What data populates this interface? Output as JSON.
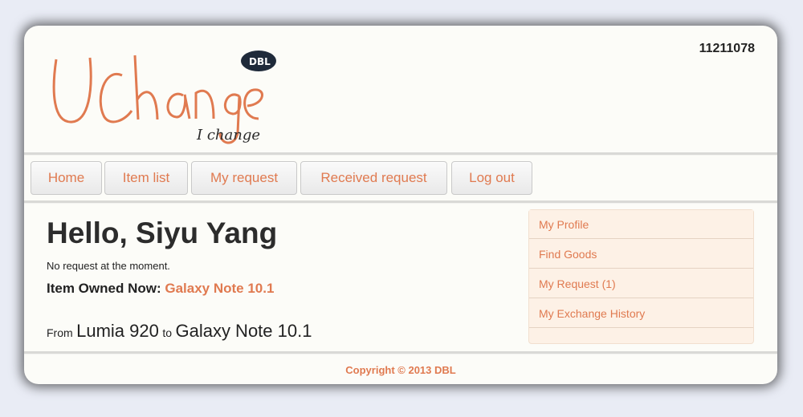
{
  "header": {
    "user_id": "11211078",
    "logo": {
      "brand": "UChange",
      "badge": "DBL",
      "tagline": "I change"
    }
  },
  "nav": {
    "items": [
      {
        "label": "Home"
      },
      {
        "label": "Item list"
      },
      {
        "label": "My request"
      },
      {
        "label": "Received request"
      },
      {
        "label": "Log out"
      }
    ]
  },
  "main": {
    "greeting": "Hello, Siyu Yang",
    "request_note": "No request at the moment.",
    "owned_label": "Item Owned Now:",
    "owned_item": "Galaxy Note 10.1",
    "history": {
      "from_word": "From",
      "from_item": "Lumia 920",
      "to_word": "to",
      "to_item": "Galaxy Note 10.1"
    }
  },
  "sidebar": {
    "items": [
      {
        "label": "My Profile"
      },
      {
        "label": "Find Goods"
      },
      {
        "label": "My Request (1)"
      },
      {
        "label": "My Exchange History"
      }
    ]
  },
  "footer": {
    "copyright": "Copyright © 2013 DBL"
  },
  "colors": {
    "accent": "#e07a50",
    "page_bg": "#fcfcf8",
    "sidebar_bg": "#fdf1e6"
  }
}
